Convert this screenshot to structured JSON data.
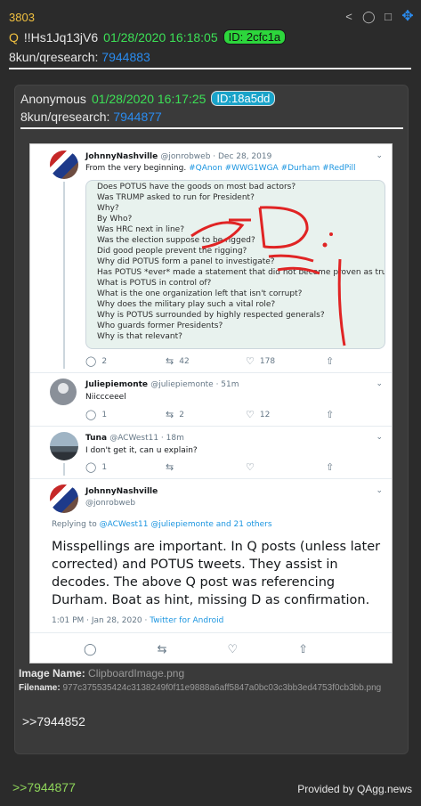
{
  "post": {
    "number": "3803",
    "q_letter": "Q",
    "tripcode": "!!Hs1Jq13jV6",
    "datetime": "01/28/2020 16:18:05",
    "id": "ID: 2cfc1a",
    "board": "8kun/qresearch:",
    "post_ref": "7944883"
  },
  "header_icons": [
    "share-icon",
    "binoculars-icon",
    "document-icon",
    "move-icon"
  ],
  "quoted": {
    "author": "Anonymous",
    "datetime": "01/28/2020 16:17:25",
    "id": "ID:18a5dd",
    "board": "8kun/qresearch:",
    "post_ref": "7944877",
    "backref": ">>7944852",
    "image_name_label": "Image Name:",
    "image_name": "ClipboardImage.png",
    "filename_label": "Filename:",
    "filename": "977c375535424c3138249f0f11e9888a6aff5847a0bc03c3bb3ed4753f0cb3bb.png"
  },
  "tweets": {
    "t1": {
      "name": "JohnnyNashville",
      "handle": "@jonrobweb · Dec 28, 2019",
      "text_prefix": "From the very beginning.",
      "tags": "#QAnon #WWG1WGA #Durham #RedPill",
      "image_lines": [
        "Does POTUS have the goods on most bad actors?",
        "Was TRUMP asked to run for President?",
        "Why?",
        "By Who?",
        "Was HRC next in line?",
        "Was the election suppose to be rigged?",
        "Did good people prevent the rigging?",
        "Why did POTUS form a panel to investigate?",
        "Has POTUS *ever* made a statement that did not become proven as true/fact?",
        "What is POTUS in control of?",
        "What is the one organization left that isn't corrupt?",
        "Why does the military play such a vital role?",
        "Why is POTUS surrounded by highly respected generals?",
        "Who guards former Presidents?",
        "Why is that relevant?"
      ],
      "replies": "2",
      "retweets": "42",
      "likes": "178"
    },
    "t2": {
      "name": "Juliepiemonte",
      "handle": "@juliepiemonte · 51m",
      "text": "Niiccceeel",
      "replies": "1",
      "retweets": "2",
      "likes": "12"
    },
    "t3": {
      "name": "Tuna",
      "handle": "@ACWest11 · 18m",
      "text": "I don't get it, can u explain?",
      "replies": "1",
      "retweets": "",
      "likes": ""
    },
    "t4": {
      "name": "JohnnyNashville",
      "handle": "@jonrobweb",
      "replying_prefix": "Replying to",
      "replying_to": "@ACWest11 @juliepiemonte and 21 others",
      "text": "Misspellings are important. In Q posts (unless later corrected) and POTUS tweets. They assist in decodes. The above Q post was referencing Durham. Boat as hint, missing D as confirmation.",
      "time": "1:01 PM · Jan 28, 2020 ·",
      "client": "Twitter for Android"
    }
  },
  "footer": {
    "link": ">>7944877",
    "credit": "Provided by QAgg.news"
  }
}
